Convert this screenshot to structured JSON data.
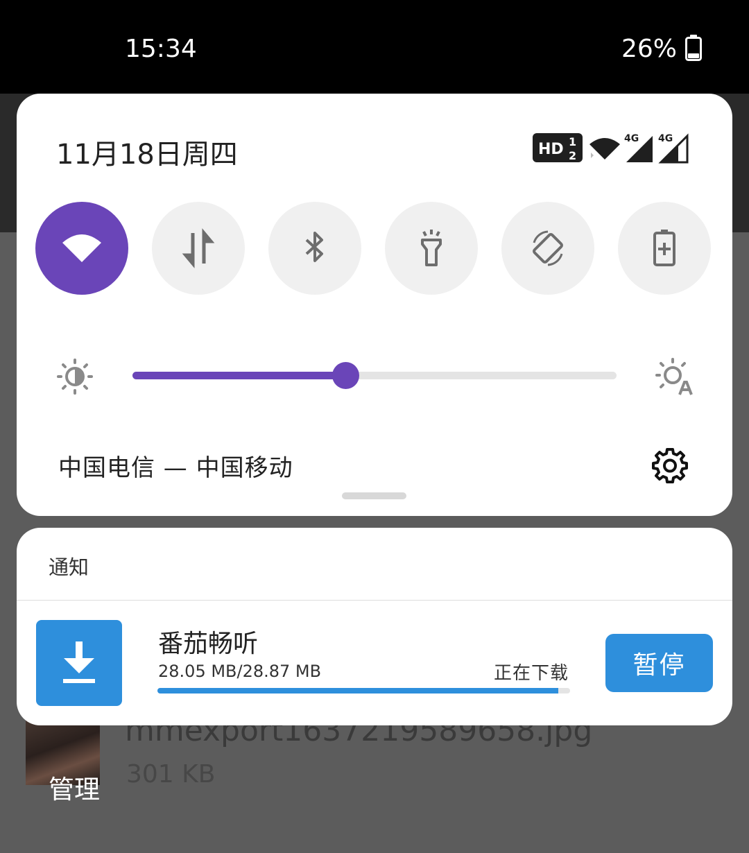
{
  "status_bar": {
    "time": "15:34",
    "battery_percent": "26%",
    "battery_level": 0.26
  },
  "quick_settings": {
    "date": "11月18日周四",
    "indicators": {
      "hd_label": "HD",
      "sim1_label": "1",
      "sim2_label": "2",
      "network1": "4G",
      "network2": "4G"
    },
    "tiles": [
      {
        "name": "wifi-icon",
        "active": true
      },
      {
        "name": "mobile-data-icon",
        "active": false
      },
      {
        "name": "bluetooth-icon",
        "active": false
      },
      {
        "name": "flashlight-icon",
        "active": false
      },
      {
        "name": "auto-rotate-icon",
        "active": false
      },
      {
        "name": "battery-saver-icon",
        "active": false
      }
    ],
    "brightness_level": 0.44,
    "carrier": "中国电信 — 中国移动"
  },
  "notifications": {
    "header": "通知",
    "items": [
      {
        "title": "番茄畅听",
        "progress_text": "28.05 MB/28.87 MB",
        "status": "正在下载",
        "progress": 0.972,
        "action_label": "暂停"
      }
    ]
  },
  "background": {
    "manage_label": "管理",
    "file_name": "mmexport1637219589658.jpg",
    "file_size": "301 KB"
  },
  "colors": {
    "accent": "#6a45b8",
    "notification_blue": "#2e8fdc"
  }
}
